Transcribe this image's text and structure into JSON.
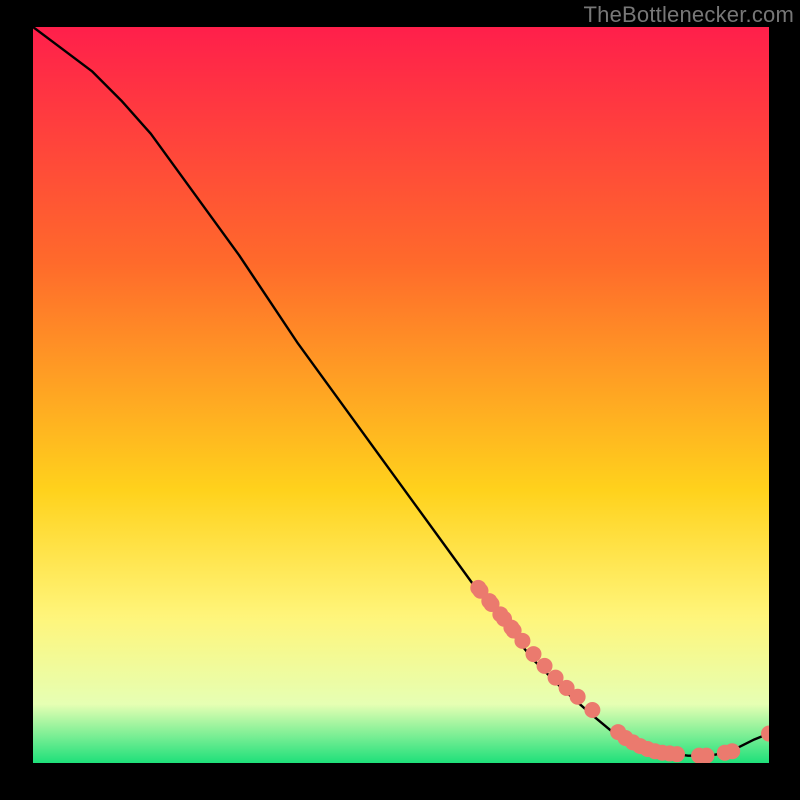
{
  "watermark": "TheBottlenecker.com",
  "colors": {
    "gradient_top": "#ff1f4b",
    "gradient_mid1": "#ff6a2b",
    "gradient_mid2": "#ffd21c",
    "gradient_mid3": "#fff57a",
    "gradient_mid4": "#e6ffb3",
    "gradient_bottom": "#1ee07a",
    "curve": "#000000",
    "marker": "#eb7a6e",
    "frame": "#000000"
  },
  "chart_data": {
    "type": "line",
    "title": "",
    "xlabel": "",
    "ylabel": "",
    "xlim": [
      0,
      100
    ],
    "ylim": [
      0,
      100
    ],
    "grid": false,
    "series": [
      {
        "name": "bottleneck-curve",
        "x": [
          0,
          4,
          8,
          12,
          16,
          20,
          24,
          28,
          32,
          36,
          40,
          44,
          48,
          52,
          56,
          60,
          64,
          68,
          72,
          76,
          79,
          82,
          86,
          89,
          92,
          94,
          96,
          98,
          100
        ],
        "y": [
          100,
          97,
          94,
          90,
          85.5,
          80,
          74.5,
          69,
          63,
          57,
          51.5,
          46,
          40.5,
          35,
          29.5,
          24,
          19,
          14,
          10,
          6.5,
          4,
          2.4,
          1.4,
          1,
          1,
          1.4,
          2.2,
          3.2,
          4
        ]
      }
    ],
    "markers": {
      "name": "highlighted-points",
      "x": [
        60.5,
        60.8,
        62,
        62.3,
        63.5,
        64,
        65,
        65.3,
        66.5,
        68,
        69.5,
        71,
        72.5,
        74,
        76,
        79.5,
        80.5,
        81.5,
        82.5,
        83.5,
        84.5,
        85.5,
        86.5,
        87.5,
        90.5,
        91.5,
        94,
        95,
        100
      ],
      "y": [
        23.8,
        23.4,
        22,
        21.6,
        20.2,
        19.6,
        18.4,
        18.0,
        16.6,
        14.8,
        13.2,
        11.6,
        10.2,
        9,
        7.2,
        4.2,
        3.4,
        2.8,
        2.3,
        1.9,
        1.6,
        1.4,
        1.3,
        1.2,
        1.0,
        1.0,
        1.4,
        1.6,
        4
      ]
    }
  }
}
